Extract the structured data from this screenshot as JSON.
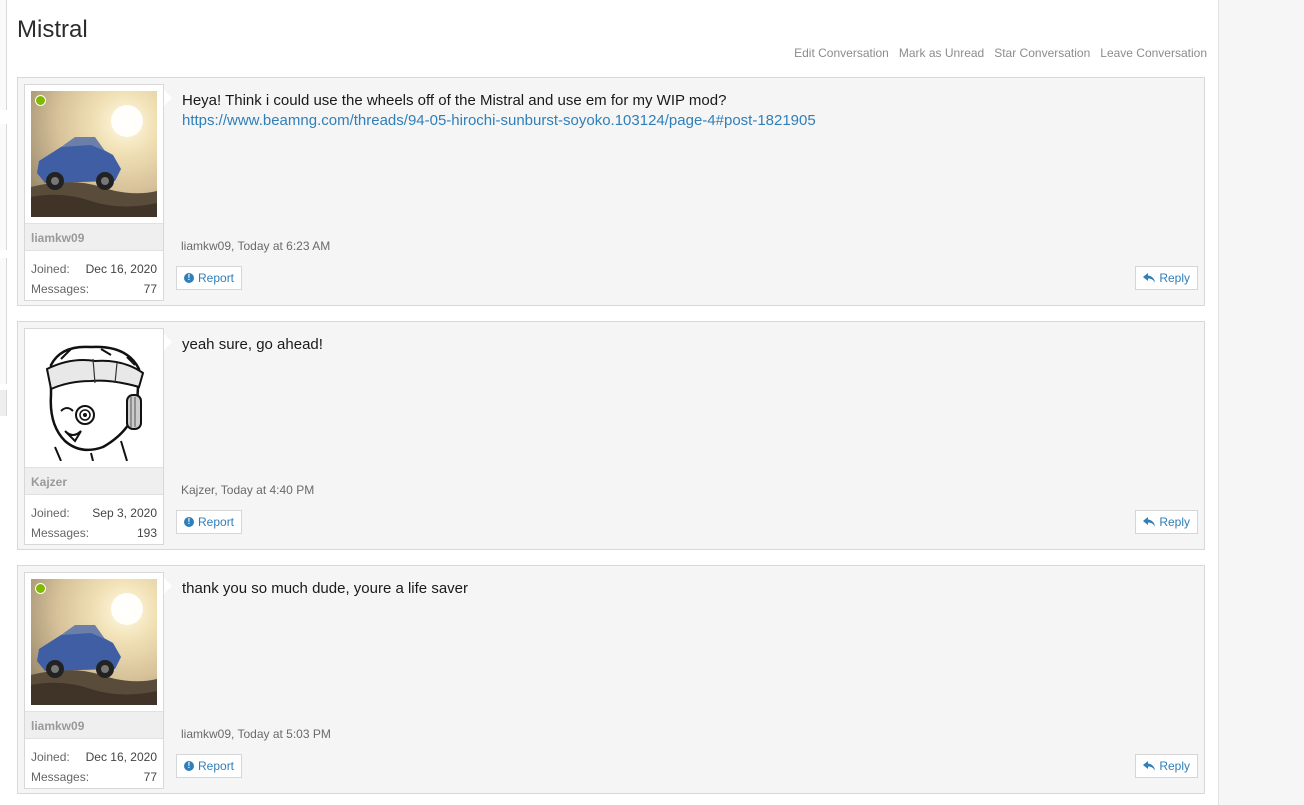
{
  "page": {
    "title": "Mistral"
  },
  "conversation_actions": {
    "edit": "Edit Conversation",
    "mark_unread": "Mark as Unread",
    "star": "Star Conversation",
    "leave": "Leave Conversation"
  },
  "labels": {
    "joined": "Joined:",
    "messages": "Messages:",
    "report": "Report",
    "reply": "Reply"
  },
  "messages": [
    {
      "user": {
        "name": "liamkw09",
        "joined": "Dec 16, 2020",
        "messages": "77",
        "online": true
      },
      "text": "Heya! Think i could use the wheels off of the Mistral and use em for my WIP mod?",
      "link": "https://www.beamng.com/threads/94-05-hirochi-sunburst-soyoko.103124/page-4#post-1821905",
      "meta": "liamkw09, Today at 6:23 AM"
    },
    {
      "user": {
        "name": "Kajzer",
        "joined": "Sep 3, 2020",
        "messages": "193",
        "online": false
      },
      "text": "yeah sure, go ahead!",
      "meta": "Kajzer, Today at 4:40 PM"
    },
    {
      "user": {
        "name": "liamkw09",
        "joined": "Dec 16, 2020",
        "messages": "77",
        "online": true
      },
      "text": "thank you so much dude, youre a life saver",
      "meta": "liamkw09, Today at 5:03 PM"
    }
  ],
  "colors": {
    "link": "#2f7fba",
    "online": "#7fb900",
    "message_bg": "#f5f5f5"
  }
}
